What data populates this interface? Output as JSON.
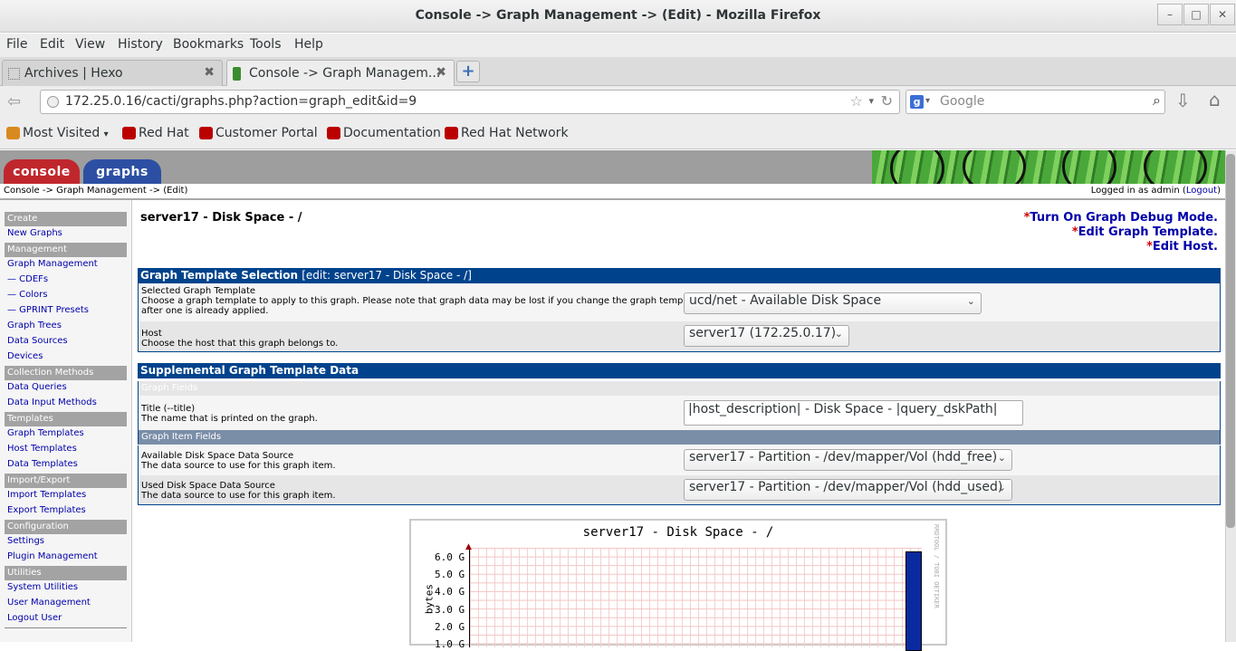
{
  "window": {
    "title": "Console -> Graph Management -> (Edit) - Mozilla Firefox"
  },
  "menu": [
    "File",
    "Edit",
    "View",
    "History",
    "Bookmarks",
    "Tools",
    "Help"
  ],
  "tabs": [
    {
      "label": "Archives | Hexo"
    },
    {
      "label": "Console -> Graph Managem..."
    }
  ],
  "nav": {
    "url": "172.25.0.16/cacti/graphs.php?action=graph_edit&id=9",
    "search_placeholder": "Google"
  },
  "bookmarks": [
    "Most Visited",
    "Red Hat",
    "Customer Portal",
    "Documentation",
    "Red Hat Network"
  ],
  "cacti": {
    "tabs": [
      "console",
      "graphs"
    ],
    "breadcrumb": {
      "console": "Console",
      "sep1": "->",
      "gm": "Graph Management",
      "sep2": "->",
      "edit": "(Edit)"
    },
    "logged_in_prefix": "Logged in as admin (",
    "logout": "Logout",
    "logged_in_suffix": ")"
  },
  "sidebar": {
    "create_header": "Create",
    "new_graphs": "New Graphs",
    "management_header": "Management",
    "graph_management": "Graph Management",
    "cdefs": "— CDEFs",
    "colors": "— Colors",
    "gprint": "— GPRINT Presets",
    "graph_trees": "Graph Trees",
    "data_sources": "Data Sources",
    "devices": "Devices",
    "collection_header": "Collection Methods",
    "data_queries": "Data Queries",
    "data_input_methods": "Data Input Methods",
    "templates_header": "Templates",
    "graph_templates": "Graph Templates",
    "host_templates": "Host Templates",
    "data_templates": "Data Templates",
    "importexport_header": "Import/Export",
    "import_templates": "Import Templates",
    "export_templates": "Export Templates",
    "configuration_header": "Configuration",
    "settings": "Settings",
    "plugin_management": "Plugin Management",
    "utilities_header": "Utilities",
    "system_utilities": "System Utilities",
    "user_management": "User Management",
    "logout_user": "Logout User"
  },
  "main": {
    "heading": "server17 - Disk Space - /",
    "links": {
      "debug": "Turn On Graph Debug Mode.",
      "edit_template": "Edit Graph Template.",
      "edit_host": "Edit Host.",
      "star": "*"
    },
    "template_section": {
      "title": "Graph Template Selection",
      "edit_note": "[edit: server17 - Disk Space - /]"
    },
    "selected_template": {
      "label": "Selected Graph Template",
      "desc1": "Choose a graph template to apply to this graph. Please note that graph data may be lost if you change the graph template",
      "desc2": "after one is already applied.",
      "value": "ucd/net - Available Disk Space"
    },
    "host": {
      "label": "Host",
      "desc": "Choose the host that this graph belongs to.",
      "value": "server17 (172.25.0.17)"
    },
    "supplemental_section": {
      "title": "Supplemental Graph Template Data"
    },
    "graph_fields": "Graph Fields",
    "title_field": {
      "label": "Title (--title)",
      "desc": "The name that is printed on the graph.",
      "value": "|host_description| - Disk Space - |query_dskPath|"
    },
    "graph_item_fields": "Graph Item Fields",
    "available_ds": {
      "label": "Available Disk Space Data Source",
      "desc": "The data source to use for this graph item.",
      "value": "server17 - Partition - /dev/mapper/Vol (hdd_free)"
    },
    "used_ds": {
      "label": "Used Disk Space Data Source",
      "desc": "The data source to use for this graph item.",
      "value": "server17 - Partition - /dev/mapper/Vol (hdd_used)"
    }
  },
  "graph_image": {
    "title": "server17 - Disk Space - /",
    "ylabel": "bytes",
    "yticks": [
      "6.0 G",
      "5.0 G",
      "4.0 G",
      "3.0 G",
      "2.0 G",
      "1.0 G"
    ],
    "watermark": "RRDTOOL / TOBI OETIKER"
  },
  "colors": {
    "section_blue": "#00438c",
    "console_tab": "#c0272d",
    "graphs_tab": "#2c4fa3",
    "link": "#0000aa"
  }
}
